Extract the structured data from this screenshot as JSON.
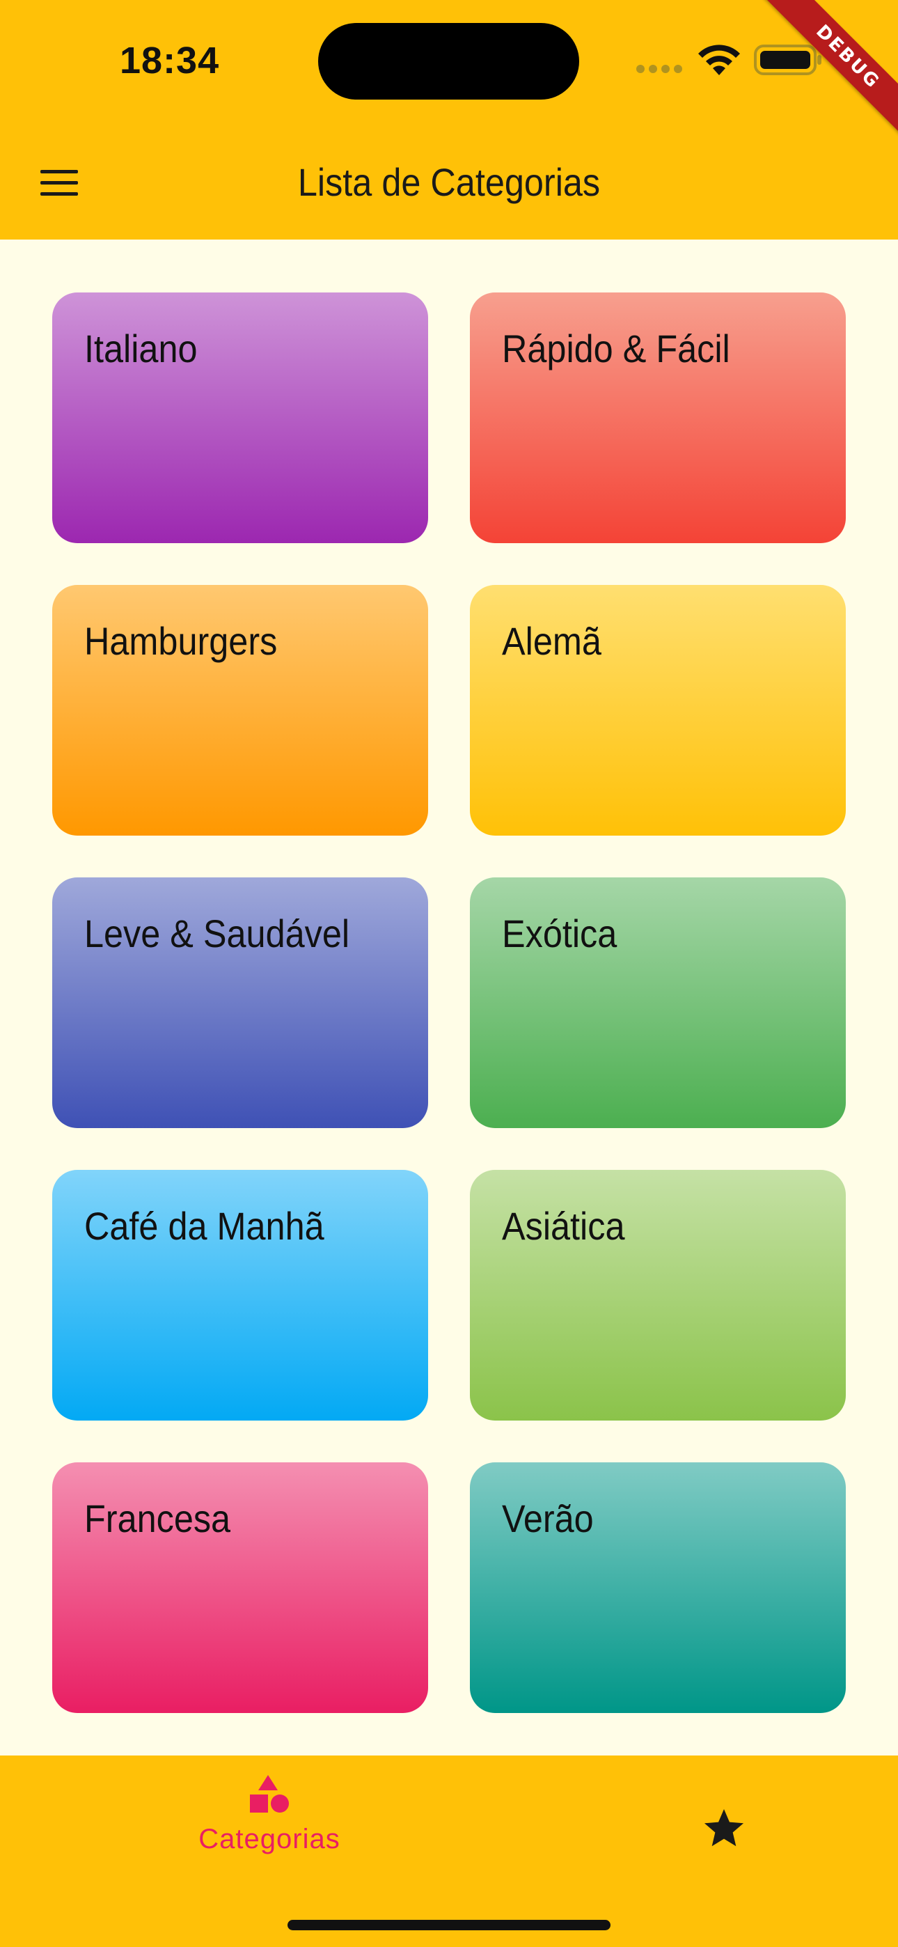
{
  "status_bar": {
    "time": "18:34"
  },
  "debug_banner": "DEBUG",
  "app_bar": {
    "title": "Lista de Categorias",
    "menu_icon": "hamburger-menu-icon"
  },
  "categories": [
    {
      "label": "Italiano",
      "color_top": "#ce93d8",
      "color_bottom": "#9c27b0"
    },
    {
      "label": "Rápido & Fácil",
      "color_top": "#f79f8e",
      "color_bottom": "#f44336"
    },
    {
      "label": "Hamburgers",
      "color_top": "#ffc870",
      "color_bottom": "#ff9800"
    },
    {
      "label": "Alemã",
      "color_top": "#ffdf70",
      "color_bottom": "#ffc107"
    },
    {
      "label": "Leve & Saudável",
      "color_top": "#9fa8da",
      "color_bottom": "#3f51b5"
    },
    {
      "label": "Exótica",
      "color_top": "#a5d6a7",
      "color_bottom": "#4caf50"
    },
    {
      "label": "Café da Manhã",
      "color_top": "#81d4fa",
      "color_bottom": "#03a9f4"
    },
    {
      "label": "Asiática",
      "color_top": "#c5e1a5",
      "color_bottom": "#8bc34a"
    },
    {
      "label": "Francesa",
      "color_top": "#f48fb1",
      "color_bottom": "#e91e63"
    },
    {
      "label": "Verão",
      "color_top": "#80cbc4",
      "color_bottom": "#009688"
    }
  ],
  "bottom_nav": {
    "categories_label": "Categorias",
    "categories_icon": "category-shapes-icon",
    "favorites_icon": "star-icon",
    "active_color": "#e91e63"
  }
}
